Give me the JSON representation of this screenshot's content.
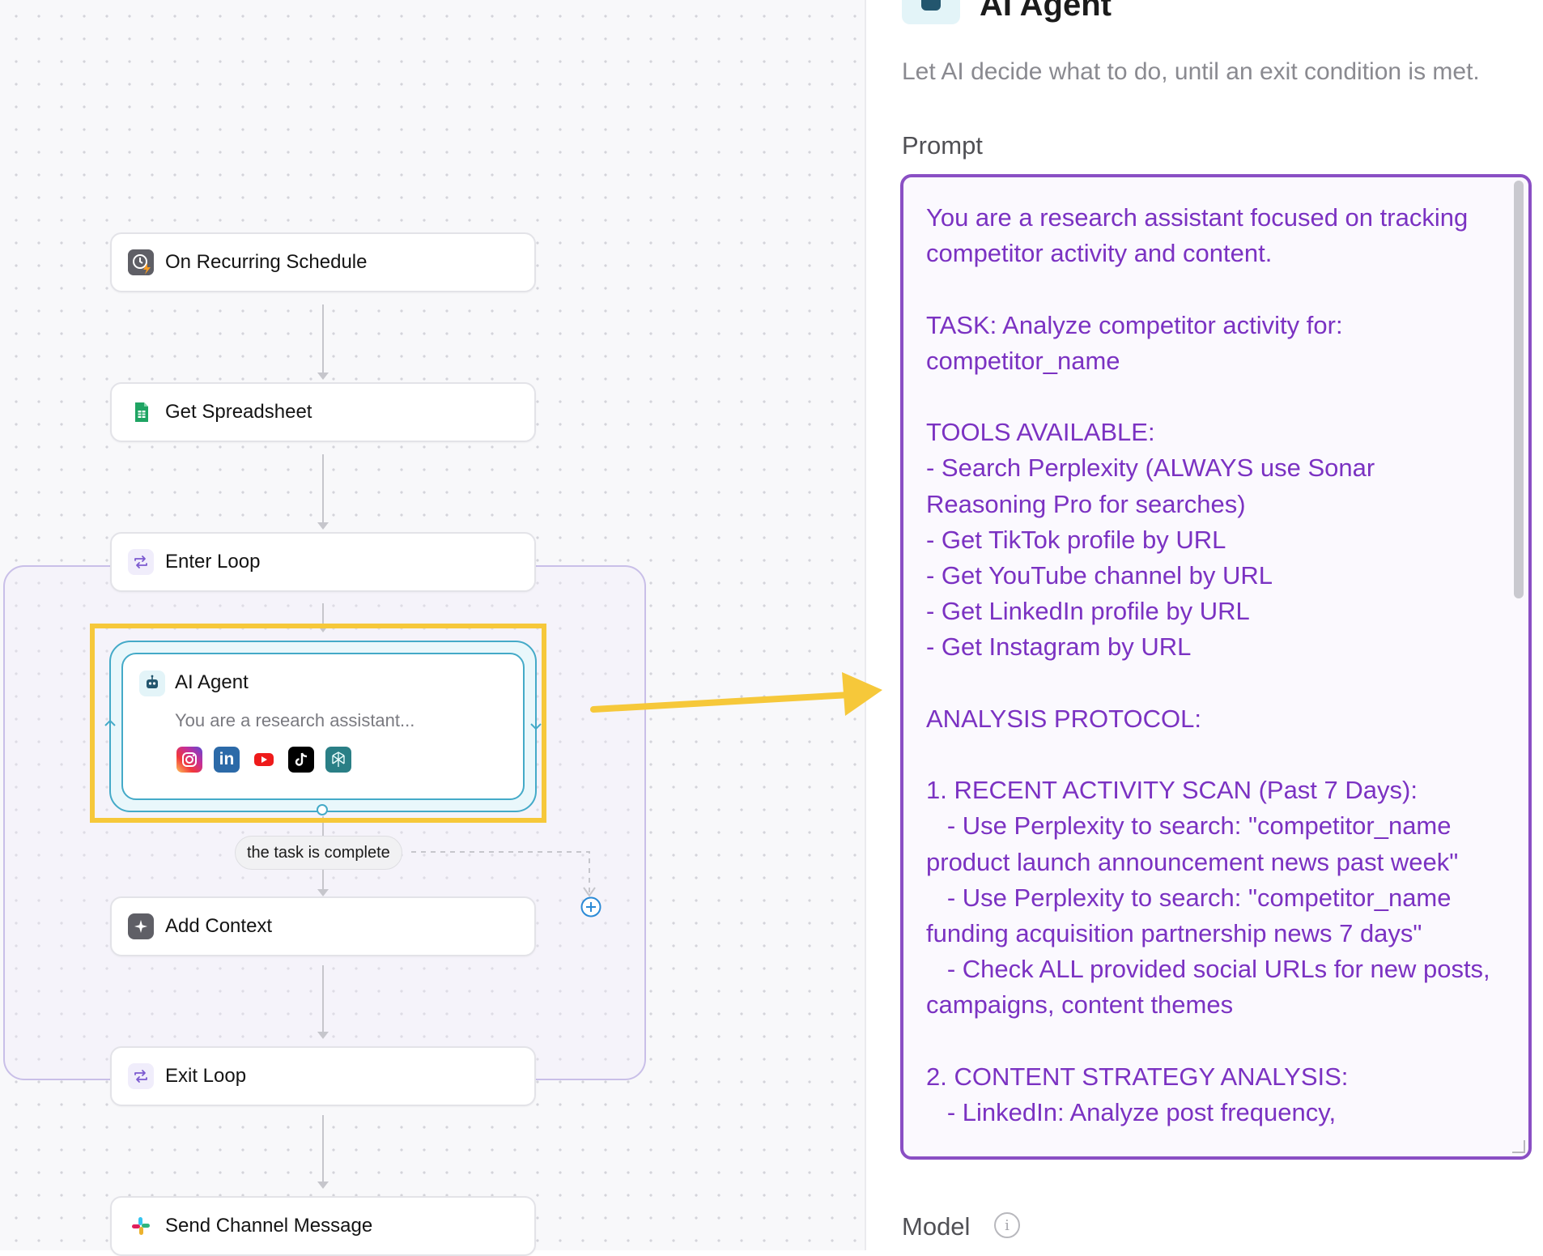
{
  "workflow": {
    "nodes": [
      {
        "label": "On Recurring Schedule",
        "icon": "clock-bolt-icon"
      },
      {
        "label": "Get Spreadsheet",
        "icon": "google-sheets-icon"
      },
      {
        "label": "Enter Loop",
        "icon": "loop-icon"
      },
      {
        "label": "Add Context",
        "icon": "sparkle-icon"
      },
      {
        "label": "Exit Loop",
        "icon": "loop-icon"
      },
      {
        "label": "Send Channel Message",
        "icon": "slack-icon"
      }
    ],
    "agent_node": {
      "title": "AI Agent",
      "subtitle": "You are a research assistant...",
      "tools": [
        "instagram-icon",
        "linkedin-icon",
        "youtube-icon",
        "tiktok-icon",
        "perplexity-icon"
      ]
    },
    "exit_condition": "the task is complete"
  },
  "panel": {
    "title": "AI Agent",
    "description": "Let AI decide what to do, until an exit condition is met.",
    "prompt_label": "Prompt",
    "prompt_text": "You are a research assistant focused on tracking competitor activity and content.\n\nTASK: Analyze competitor activity for: competitor_name\n\nTOOLS AVAILABLE:\n- Search Perplexity (ALWAYS use Sonar Reasoning Pro for searches)\n- Get TikTok profile by URL\n- Get YouTube channel by URL\n- Get LinkedIn profile by URL\n- Get Instagram by URL\n\nANALYSIS PROTOCOL:\n\n1. RECENT ACTIVITY SCAN (Past 7 Days):\n   - Use Perplexity to search: \"competitor_name product launch announcement news past week\"\n   - Use Perplexity to search: \"competitor_name funding acquisition partnership news 7 days\"\n   - Check ALL provided social URLs for new posts, campaigns, content themes\n\n2. CONTENT STRATEGY ANALYSIS:\n   - LinkedIn: Analyze post frequency,",
    "model_label": "Model"
  },
  "colors": {
    "accent_purple": "#8a4fc4",
    "prompt_text": "#7b32c2",
    "agent_border": "#44aac8",
    "highlight_yellow": "#f6c83a"
  }
}
